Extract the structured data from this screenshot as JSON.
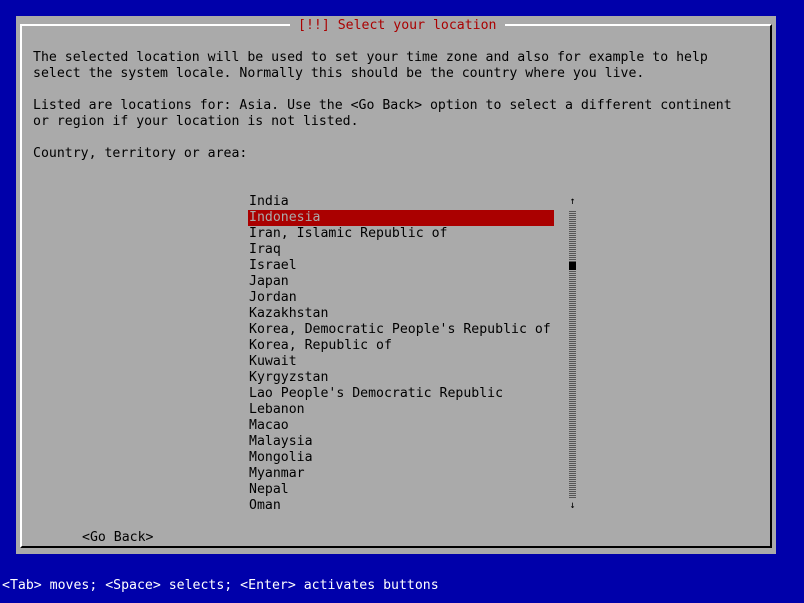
{
  "dialog": {
    "title": "[!!] Select your location",
    "description_lines": [
      "The selected location will be used to set your time zone and also for example to help",
      "select the system locale. Normally this should be the country where you live."
    ],
    "region_lines": [
      "Listed are locations for: Asia. Use the <Go Back> option to select a different continent",
      "or region if your location is not listed."
    ],
    "list_label": "Country, territory or area:",
    "countries": [
      "India",
      "Indonesia",
      "Iran, Islamic Republic of",
      "Iraq",
      "Israel",
      "Japan",
      "Jordan",
      "Kazakhstan",
      "Korea, Democratic People's Republic of",
      "Korea, Republic of",
      "Kuwait",
      "Kyrgyzstan",
      "Lao People's Democratic Republic",
      "Lebanon",
      "Macao",
      "Malaysia",
      "Mongolia",
      "Myanmar",
      "Nepal",
      "Oman"
    ],
    "selected_country": "Indonesia",
    "scroll_up_glyph": "↑",
    "scroll_down_glyph": "↓",
    "go_back_label": "<Go Back>"
  },
  "status_bar": {
    "text": "<Tab> moves; <Space> selects; <Enter> activates buttons"
  },
  "colors": {
    "background": "#0000aa",
    "dialog": "#aaaaaa",
    "accent": "#aa0000",
    "status_text": "#ffffff"
  }
}
